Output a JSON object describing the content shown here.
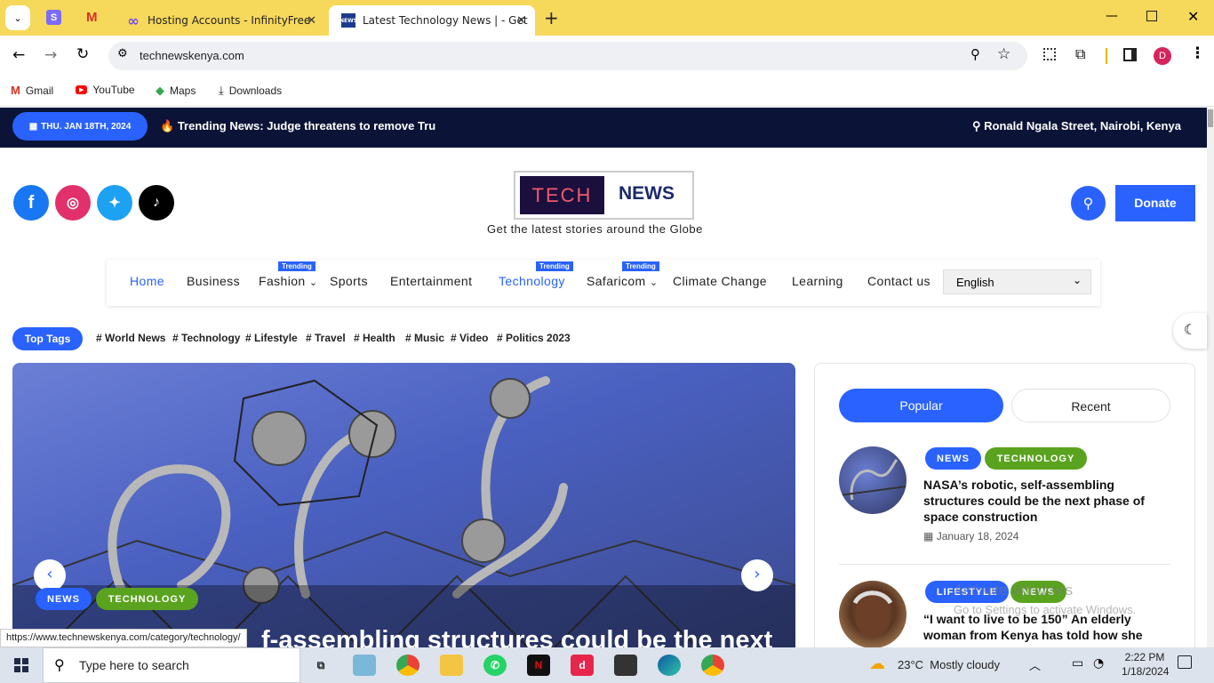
{
  "browser": {
    "tabs": [
      {
        "label": "Hosting Accounts - InfinityFree",
        "active": false
      },
      {
        "label": "Latest Technology News | - Get",
        "active": true
      }
    ],
    "new_tab": "+",
    "url": "technewskenya.com",
    "profile_initial": "D",
    "bookmarks": [
      "Gmail",
      "YouTube",
      "Maps",
      "Downloads"
    ],
    "status_url": "https://www.technewskenya.com/category/technology/"
  },
  "site": {
    "date": "THU. JAN 18TH, 2024",
    "trending_label": "Trending News:",
    "trending_text": "Judge threatens to remove Tru",
    "location": "Ronald Ngala Street, Nairobi, Kenya",
    "logo_left": "TECH",
    "logo_right": "NEWS",
    "tagline": "Get the latest stories around the Globe",
    "donate": "Donate",
    "nav": [
      {
        "label": "Home",
        "active": true
      },
      {
        "label": "Business"
      },
      {
        "label": "Fashion",
        "badge": "Trending",
        "dropdown": true
      },
      {
        "label": "Sports"
      },
      {
        "label": "Entertainment"
      },
      {
        "label": "Technology",
        "badge": "Trending",
        "active": true
      },
      {
        "label": "Safaricom",
        "badge": "Trending",
        "dropdown": true
      },
      {
        "label": "Climate Change"
      },
      {
        "label": "Learning"
      },
      {
        "label": "Contact us"
      }
    ],
    "language": "English",
    "top_tags_label": "Top Tags",
    "tags": [
      "World News",
      "Technology",
      "Lifestyle",
      "Travel",
      "Health",
      "Music",
      "Video",
      "Politics 2023"
    ],
    "hero": {
      "categories": [
        "NEWS",
        "TECHNOLOGY"
      ],
      "title_partial": "f-assembling structures could be the next"
    },
    "sidebar": {
      "tabs": [
        "Popular",
        "Recent"
      ],
      "posts": [
        {
          "categories": [
            "NEWS",
            "TECHNOLOGY"
          ],
          "title": "NASA’s robotic, self-assembling structures could be the next phase of space construction",
          "date": "January 18, 2024"
        },
        {
          "categories": [
            "LIFESTYLE",
            "NEWS"
          ],
          "title": "“I want to live to be 150” An elderly woman from Kenya has told how she",
          "date": ""
        }
      ]
    },
    "watermark": {
      "line1": "Activate Windows",
      "line2": "Go to Settings to activate Windows."
    }
  },
  "taskbar": {
    "search_placeholder": "Type here to search",
    "weather": "23°C  Mostly cloudy",
    "time": "2:22 PM",
    "date": "1/18/2024"
  },
  "colors": {
    "accent": "#2962ff",
    "topbar": "#0b1437",
    "tech_green": "#5aa31f",
    "tabstrip": "#f6d85b"
  }
}
